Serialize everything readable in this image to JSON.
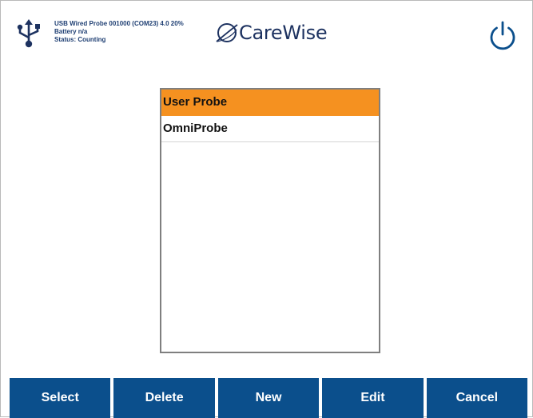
{
  "header": {
    "icons": {
      "connection": "usb-icon",
      "logo": "carewise-logo-icon",
      "power": "power-icon"
    },
    "status_lines": [
      "USB Wired Probe 001000 (COM23) 4.0 20%",
      "Battery n/a",
      "Status: Counting"
    ],
    "logo_text": "CareWise"
  },
  "probe_list": {
    "items": [
      {
        "label": "User Probe",
        "selected": true
      },
      {
        "label": "OmniProbe",
        "selected": false
      }
    ]
  },
  "toolbar": {
    "buttons": [
      {
        "label": "Select"
      },
      {
        "label": "Delete"
      },
      {
        "label": "New"
      },
      {
        "label": "Edit"
      },
      {
        "label": "Cancel"
      }
    ]
  },
  "colors": {
    "primary_button": "#0b4f8c",
    "selection": "#f59120",
    "header_text": "#1f3f73",
    "logo_text": "#1d3260"
  }
}
